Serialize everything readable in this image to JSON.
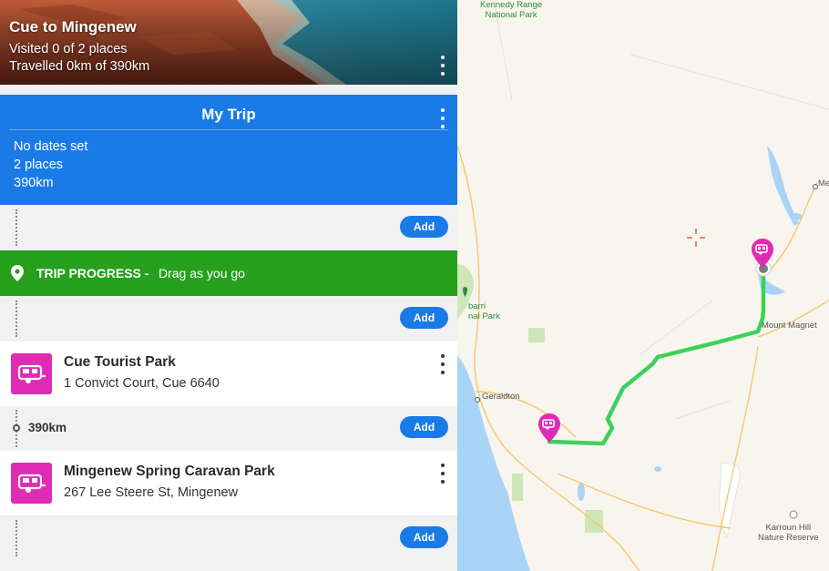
{
  "trip_header": {
    "title": "Cue to Mingenew",
    "visited": "Visited 0 of 2 places",
    "travelled": "Travelled 0km of 390km"
  },
  "my_trip": {
    "title": "My Trip",
    "dates": "No dates set",
    "places": "2 places",
    "distance": "390km"
  },
  "add_label": "Add",
  "progress": {
    "label": "TRIP PROGRESS -",
    "hint": "Drag as you go",
    "icon": "map-pin-icon"
  },
  "stops": [
    {
      "name": "Cue Tourist Park",
      "address": "1 Convict Court, Cue 6640",
      "icon": "caravan-icon"
    },
    {
      "name": "Mingenew Spring Caravan Park",
      "address": "267 Lee Steere St, Mingenew",
      "icon": "caravan-icon"
    }
  ],
  "leg_distance": "390km",
  "map": {
    "labels": {
      "kennedy_line1": "Kennedy Range",
      "kennedy_line2": "National Park",
      "me": "Me",
      "barri_line1": "barri",
      "barri_line2": "nal Park",
      "mount_magnet": "Mount Magnet",
      "geraldton": "Geraldton",
      "karroun_line1": "Karroun Hill",
      "karroun_line2": "Nature Reserve"
    }
  },
  "colors": {
    "accent": "#1a7be6",
    "progress": "#27a01d",
    "caravan": "#e02cb5",
    "route": "#3ed15a"
  }
}
